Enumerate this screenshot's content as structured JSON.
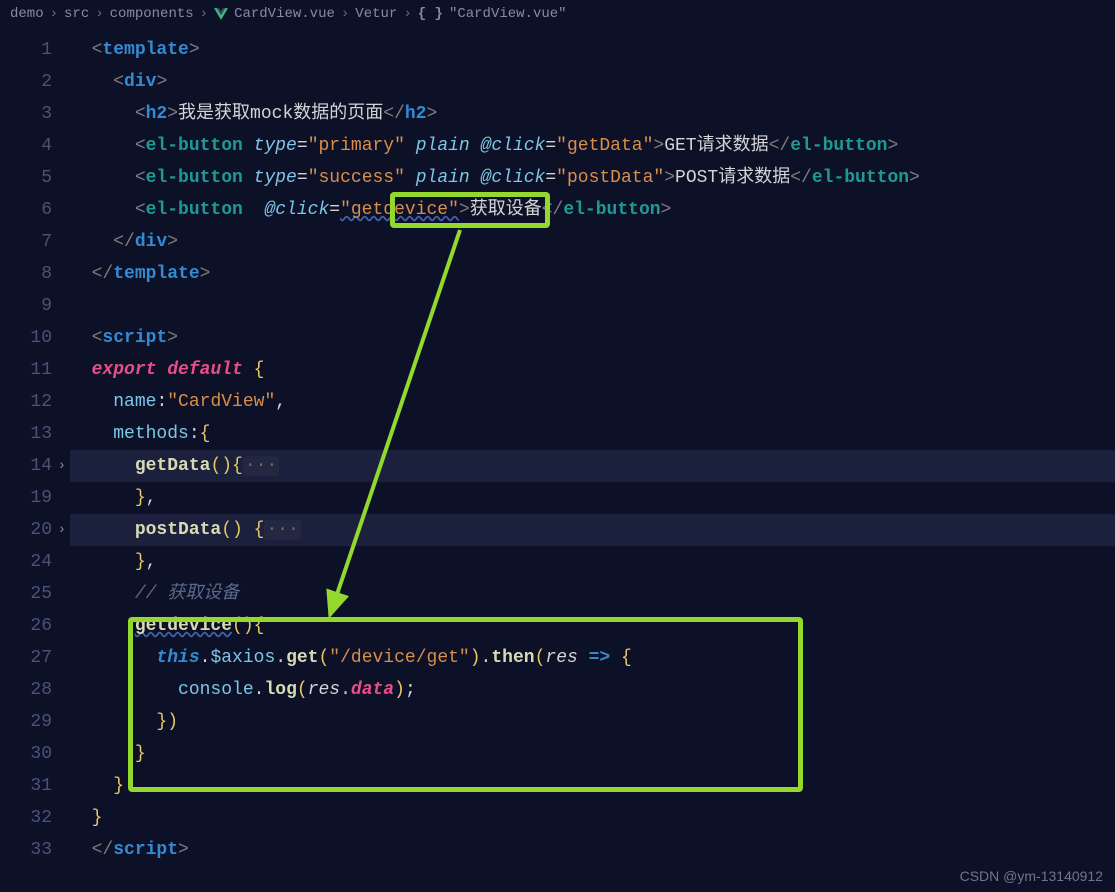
{
  "breadcrumb": [
    "demo",
    "src",
    "components",
    "CardView.vue",
    "Vetur",
    "{ }",
    "\"CardView.vue\""
  ],
  "lineNumbers": [
    "1",
    "2",
    "3",
    "4",
    "5",
    "6",
    "7",
    "8",
    "9",
    "10",
    "11",
    "12",
    "13",
    "14",
    "19",
    "20",
    "24",
    "25",
    "26",
    "27",
    "28",
    "29",
    "30",
    "31",
    "32",
    "33"
  ],
  "foldedLines": [
    "14",
    "20"
  ],
  "code": {
    "l1_tag": "template",
    "l2_tag": "div",
    "l3_tag": "h2",
    "l3_text": "我是获取mock数据的页面",
    "l4_tag": "el-button",
    "l4_a1": "type",
    "l4_v1": "\"primary\"",
    "l4_a2": "plain",
    "l4_a3": "@click",
    "l4_v3": "\"getData\"",
    "l4_text": "GET请求数据",
    "l5_tag": "el-button",
    "l5_a1": "type",
    "l5_v1": "\"success\"",
    "l5_a2": "plain",
    "l5_a3": "@click",
    "l5_v3": "\"postData\"",
    "l5_text": "POST请求数据",
    "l6_tag": "el-button",
    "l6_a3": "@click",
    "l6_v3": "\"getdevice\"",
    "l6_text": "获取设备",
    "l8_tag": "template",
    "l10_tag": "script",
    "l11_kw1": "export",
    "l11_kw2": "default",
    "l12_prop": "name",
    "l12_val": "\"CardView\"",
    "l13_prop": "methods",
    "l14_fn": "getData",
    "l20_fn": "postData",
    "l25_comment": "// 获取设备",
    "l26_fn": "getdevice",
    "l27_this": "this",
    "l27_ax": "$axios",
    "l27_get": "get",
    "l27_url": "\"/device/get\"",
    "l27_then": "then",
    "l27_res": "res",
    "l28_console": "console",
    "l28_log": "log",
    "l28_res": "res",
    "l28_data": "data",
    "l33_tag": "script"
  },
  "watermark": "CSDN @ym-13140912"
}
